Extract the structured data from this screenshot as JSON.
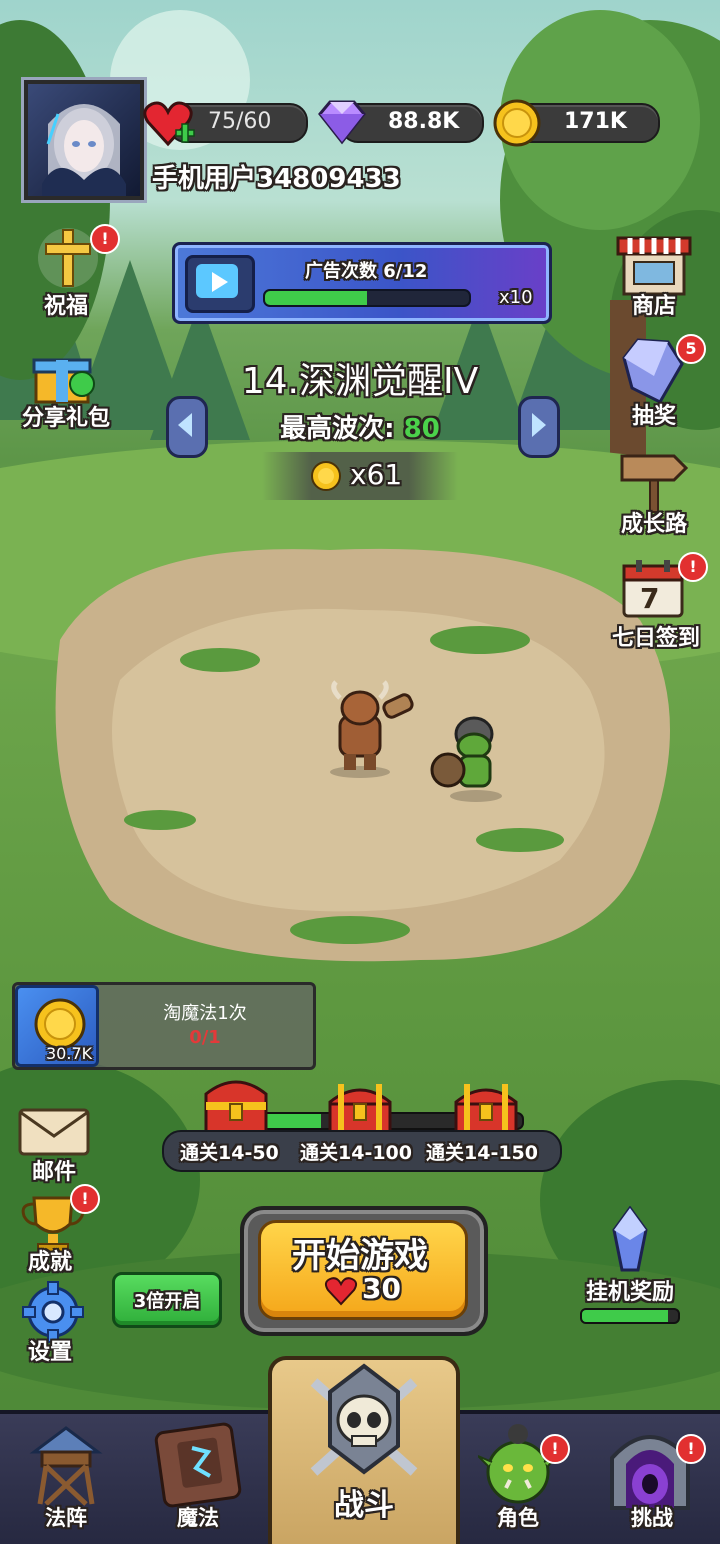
{
  "header": {
    "hearts": "75/60",
    "gems": "88.8K",
    "coins": "171K",
    "username": "手机用户34809433"
  },
  "left_menu": {
    "blessing": "祝福",
    "share_gift": "分享礼包",
    "mail": "邮件",
    "achievement": "成就",
    "settings": "设置"
  },
  "right_menu": {
    "shop": "商店",
    "lottery": "抽奖",
    "lottery_badge": "5",
    "growth_path": "成长路",
    "seven_day_signin": "七日签到",
    "calendar_day": "7",
    "idle_reward": "挂机奖励",
    "idle_reward_progress": 0.9
  },
  "ad_panel": {
    "label": "广告次数 6/12",
    "multiplier": "x10",
    "progress": 0.5
  },
  "stage": {
    "name": "14.深渊觉醒IV",
    "best_wave_label": "最高波次:",
    "best_wave_value": "80",
    "reward": "x61"
  },
  "quest": {
    "title": "淘魔法1次",
    "progress": "0/1",
    "coin_amount": "30.7K"
  },
  "chests": {
    "labels": [
      "通关14-50",
      "通关14-100",
      "通关14-150"
    ],
    "progress": 0.35
  },
  "triple_button": "3倍开启",
  "start_button": {
    "label": "开始游戏",
    "cost": "30"
  },
  "nav": {
    "formation": "法阵",
    "magic": "魔法",
    "battle": "战斗",
    "character": "角色",
    "challenge": "挑战"
  },
  "colors": {
    "gold": "#f6c21d",
    "accent_green": "#3fcb4a",
    "badge_red": "#e23030",
    "panel_blue": "#3b55c8"
  }
}
